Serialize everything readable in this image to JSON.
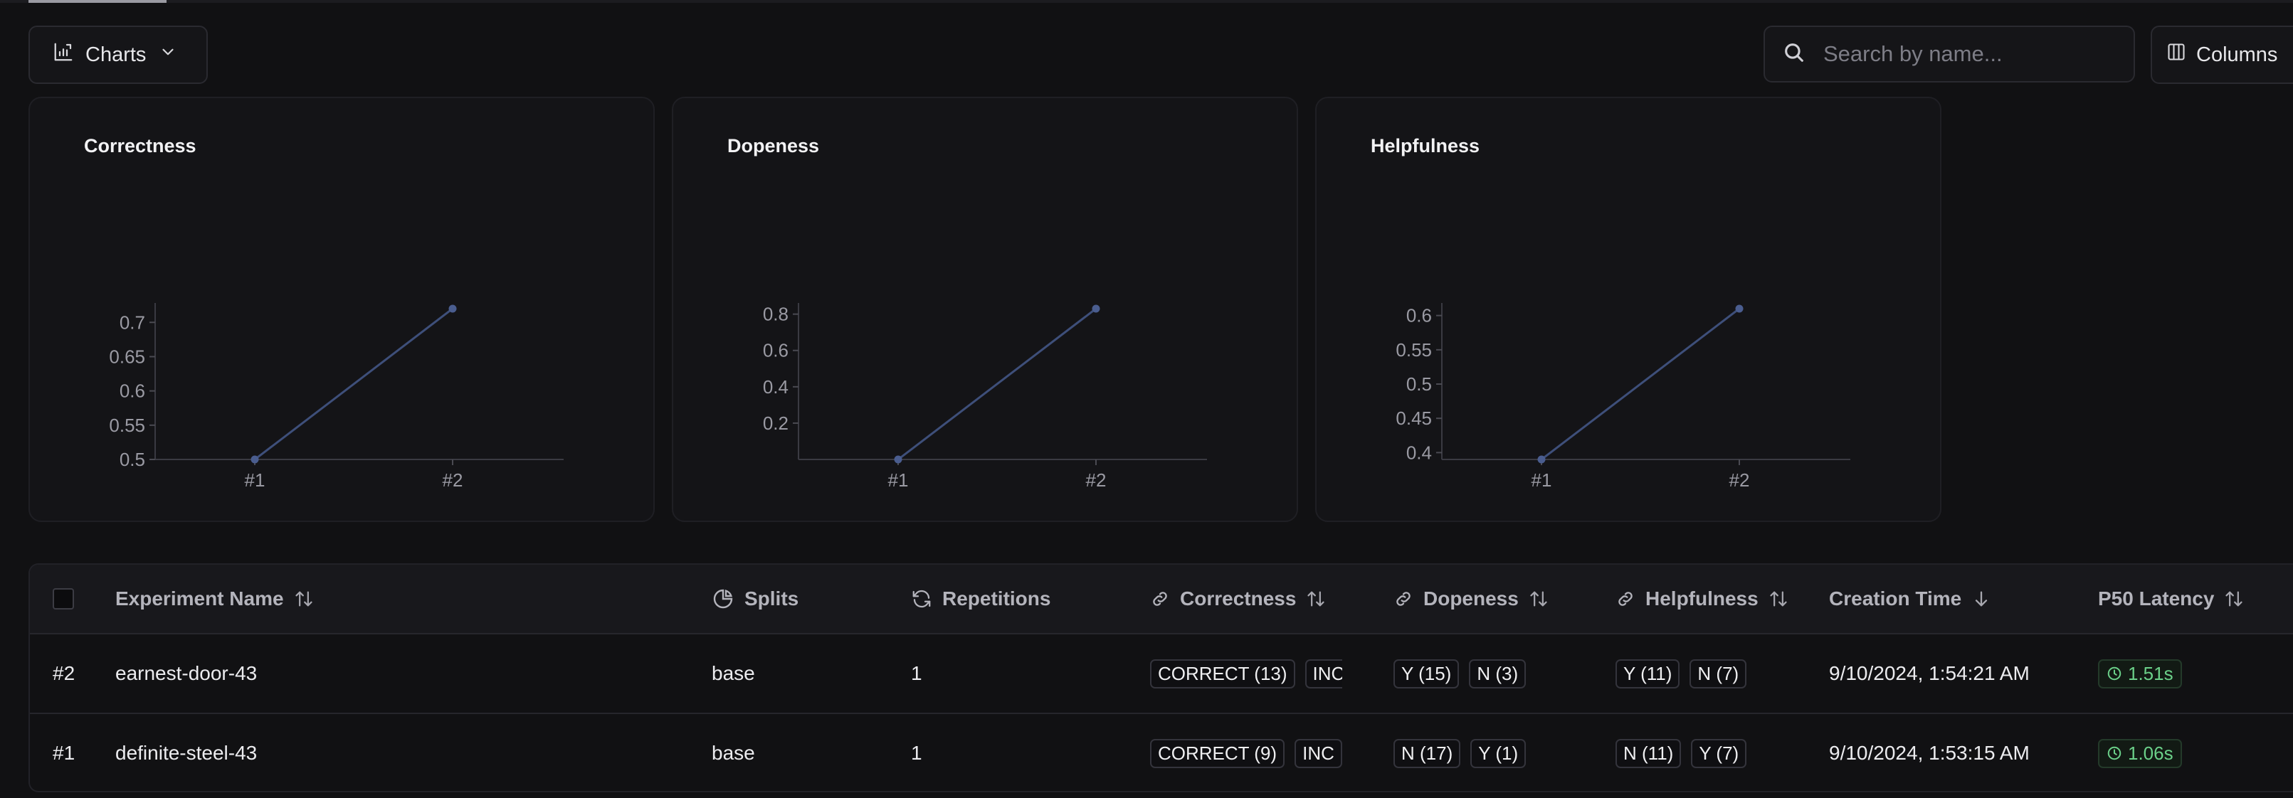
{
  "toolbar": {
    "charts_label": "Charts",
    "search_placeholder": "Search by name...",
    "columns_label": "Columns"
  },
  "chart_data": [
    {
      "type": "line",
      "title": "Correctness",
      "x": [
        "#1",
        "#2"
      ],
      "values": [
        0.5,
        0.72
      ],
      "yticks": [
        "0.5",
        "0.55",
        "0.6",
        "0.65",
        "0.7"
      ],
      "ylim": [
        0.5,
        0.72
      ],
      "color": "#3e4f7a"
    },
    {
      "type": "line",
      "title": "Dopeness",
      "x": [
        "#1",
        "#2"
      ],
      "values": [
        0.0,
        0.83
      ],
      "yticks": [
        "0.2",
        "0.4",
        "0.6",
        "0.8"
      ],
      "ylim": [
        0.0,
        0.83
      ],
      "color": "#3e4f7a"
    },
    {
      "type": "line",
      "title": "Helpfulness",
      "x": [
        "#1",
        "#2"
      ],
      "values": [
        0.39,
        0.61
      ],
      "yticks": [
        "0.4",
        "0.45",
        "0.5",
        "0.55",
        "0.6"
      ],
      "ylim": [
        0.39,
        0.61
      ],
      "color": "#3e4f7a"
    }
  ],
  "table": {
    "headers": {
      "name": "Experiment Name",
      "splits": "Splits",
      "repetitions": "Repetitions",
      "correctness": "Correctness",
      "dopeness": "Dopeness",
      "helpfulness": "Helpfulness",
      "creation": "Creation Time",
      "latency": "P50 Latency"
    },
    "rows": [
      {
        "num": "#2",
        "name": "earnest-door-43",
        "splits": "base",
        "repetitions": "1",
        "correctness": [
          "CORRECT (13)",
          "INC"
        ],
        "dopeness": [
          "Y (15)",
          "N (3)"
        ],
        "helpfulness": [
          "Y (11)",
          "N (7)"
        ],
        "created": "9/10/2024, 1:54:21 AM",
        "latency": "1.51s"
      },
      {
        "num": "#1",
        "name": "definite-steel-43",
        "splits": "base",
        "repetitions": "1",
        "correctness": [
          "CORRECT (9)",
          "INC"
        ],
        "dopeness": [
          "N (17)",
          "Y (1)"
        ],
        "helpfulness": [
          "N (11)",
          "Y (7)"
        ],
        "created": "9/10/2024, 1:53:15 AM",
        "latency": "1.06s"
      }
    ]
  }
}
